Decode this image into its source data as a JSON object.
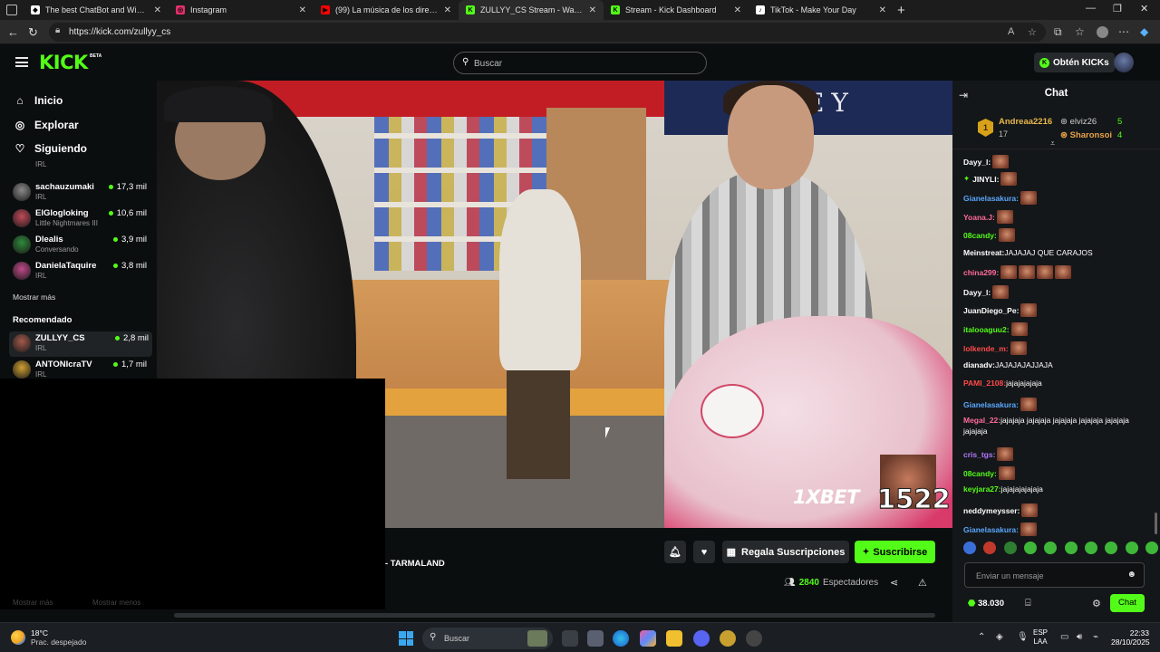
{
  "browser": {
    "tabs": [
      {
        "title": "The best ChatBot and Widgets fo",
        "fav_color": "#ffffff",
        "fav_glyph": "◆"
      },
      {
        "title": "Instagram",
        "fav_color": "#e1306c",
        "fav_glyph": "◎"
      },
      {
        "title": "(99) La música de los directos de",
        "fav_color": "#ff0000",
        "fav_glyph": "▶"
      },
      {
        "title": "ZULLYY_CS Stream - Watch Live o",
        "fav_color": "#53fc18",
        "fav_glyph": "K",
        "active": true
      },
      {
        "title": "Stream - Kick Dashboard",
        "fav_color": "#53fc18",
        "fav_glyph": "K"
      },
      {
        "title": "TikTok - Make Your Day",
        "fav_color": "#ffffff",
        "fav_glyph": "♪"
      }
    ],
    "url": "https://kick.com/zullyy_cs"
  },
  "header": {
    "logo": "KICK",
    "beta": "BETA",
    "search_placeholder": "Buscar",
    "get_kicks": "Obtén KICKs",
    "accent": "#53fc18"
  },
  "sidebar": {
    "nav": [
      {
        "label": "Inicio",
        "icon": "home-icon"
      },
      {
        "label": "Explorar",
        "icon": "compass-icon"
      },
      {
        "label": "Siguiendo",
        "icon": "heart-icon"
      }
    ],
    "partial_category": "IRL",
    "following": [
      {
        "name": "sachauzumaki",
        "sub": "IRL",
        "viewers": "17,3 mil",
        "color": "#8a8a8a"
      },
      {
        "name": "ElGlogloking",
        "sub": "Little Nightmares III",
        "viewers": "10,6 mil",
        "color": "#c24a5a"
      },
      {
        "name": "Dlealis",
        "sub": "Conversando",
        "viewers": "3,9 mil",
        "color": "#2f8a3a"
      },
      {
        "name": "DanielaTaquire",
        "sub": "IRL",
        "viewers": "3,8 mil",
        "color": "#c04a8a"
      }
    ],
    "show_more": "Mostrar más",
    "recommended_title": "Recomendado",
    "recommended": [
      {
        "name": "ZULLYY_CS",
        "sub": "IRL",
        "viewers": "2,8 mil",
        "color": "#a25a4a"
      },
      {
        "name": "ANTONIcraTV",
        "sub": "IRL",
        "viewers": "1,7 mil",
        "color": "#d0a030"
      }
    ],
    "dim_more": "Mostrar más",
    "dim_less": "Mostrar menos"
  },
  "video": {
    "sign_text": "R EY",
    "sponsor": "1XBET",
    "sponsor_code": "1522"
  },
  "stream": {
    "title": "- TARMALAND",
    "gift_label": "Regala Suscripciones",
    "subscribe_label": "Suscribirse",
    "viewers": "2840",
    "viewers_label": "Espectadores"
  },
  "chat": {
    "title": "Chat",
    "leaderboard": {
      "first": {
        "rank": "1",
        "name": "Andreaa2216",
        "count": "17"
      },
      "second": {
        "name": "elviz26",
        "count": "5"
      },
      "third": {
        "name": "Sharonsoi",
        "count": "4"
      }
    },
    "messages": [
      {
        "user": "Dayy_l:",
        "color": "#ffffff",
        "text": "",
        "emotes": 1
      },
      {
        "user": "JINYLI:",
        "color": "#ffffff",
        "text": "",
        "emotes": 1,
        "badge": true
      },
      {
        "user": "Gianelasakura:",
        "color": "#5aa8ff",
        "text": "",
        "emotes": 1
      },
      {
        "user": "Yoana.J:",
        "color": "#ff6b9a",
        "text": "",
        "emotes": 1
      },
      {
        "user": "08candy:",
        "color": "#53fc18",
        "text": "",
        "emotes": 1
      },
      {
        "user": "Meinstreat:",
        "color": "#ffffff",
        "text": " JAJAJAJ QUE CARAJOS",
        "emotes": 0
      },
      {
        "user": "china299:",
        "color": "#ff6b9a",
        "text": "",
        "emotes": 4
      },
      {
        "user": "Dayy_l:",
        "color": "#ffffff",
        "text": "",
        "emotes": 1
      },
      {
        "user": "JuanDiego_Pe:",
        "color": "#ffffff",
        "text": "",
        "emotes": 1
      },
      {
        "user": "italooaguu2:",
        "color": "#53fc18",
        "text": "",
        "emotes": 1
      },
      {
        "user": "lolkende_m:",
        "color": "#ff4a4a",
        "text": "",
        "emotes": 1
      },
      {
        "user": "dianadv:",
        "color": "#ffffff",
        "text": " JAJAJAJAJJAJA",
        "emotes": 0
      },
      {
        "user": "PAMI_2108:",
        "color": "#ff4a4a",
        "text": " jajajajajaja",
        "emotes": 0
      },
      {
        "user": "Gianelasakura:",
        "color": "#5aa8ff",
        "text": "",
        "emotes": 1
      },
      {
        "user": "Megal_22:",
        "color": "#ff6b9a",
        "text": " jajajaja jajajaja jajajaja jajajaja jajajaja",
        "text2": "jajajaja",
        "emotes": 0
      },
      {
        "user": "cris_tgs:",
        "color": "#b07aff",
        "text": "",
        "emotes": 1
      },
      {
        "user": "08candy:",
        "color": "#53fc18",
        "text": "",
        "emotes": 1
      },
      {
        "user": "keyjara27:",
        "color": "#53fc18",
        "text": " jajajajajajaja",
        "emotes": 0
      },
      {
        "user": "neddymeysser:",
        "color": "#ffffff",
        "text": "",
        "emotes": 1
      },
      {
        "user": "Gianelasakura:",
        "color": "#5aa8ff",
        "text": "",
        "emotes": 1
      }
    ],
    "input_placeholder": "Enviar un mensaje",
    "points": "38.030",
    "send_label": "Chat"
  },
  "taskbar": {
    "temp": "18°C",
    "weather": "Prac. despejado",
    "search": "Buscar",
    "lang1": "ESP",
    "lang2": "LAA",
    "time": "22:33",
    "date": "28/10/2025"
  }
}
